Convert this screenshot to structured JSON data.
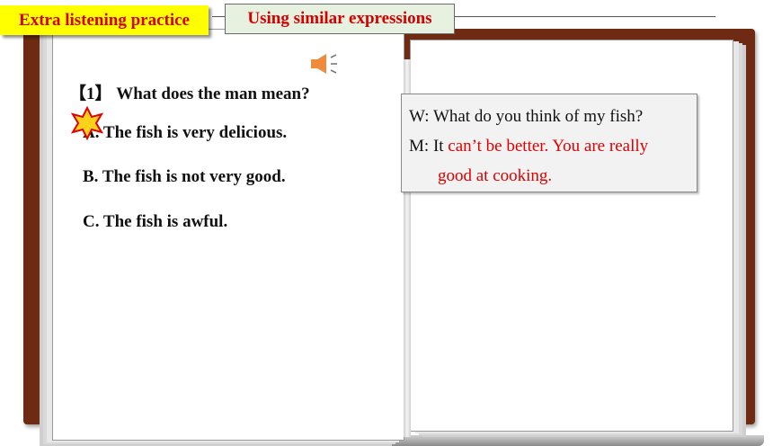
{
  "header": {
    "tag_primary": "Extra listening practice",
    "tag_secondary": "Using similar expressions"
  },
  "question": {
    "number": "【1】",
    "text": "What does the man mean?",
    "options": [
      {
        "letter": "A.",
        "text": "The fish is very delicious."
      },
      {
        "letter": "B.",
        "text": "The fish is not very good."
      },
      {
        "letter": "C.",
        "text": "The fish is awful."
      }
    ],
    "correct": "A"
  },
  "dialog": {
    "line1_speaker": "W:",
    "line1_text": "What do you think of my fish?",
    "line2_speaker": "M:",
    "line2_plain": "It",
    "line2_highlight": "can’t be better. You are really",
    "line3_highlight": "good at cooking."
  },
  "icons": [
    "speaker-icon",
    "star-icon"
  ],
  "colors": {
    "accent_red": "#e00000",
    "tag_yellow": "#ffff00",
    "tag_green": "#e6f1df",
    "cover": "#6e2a12"
  }
}
